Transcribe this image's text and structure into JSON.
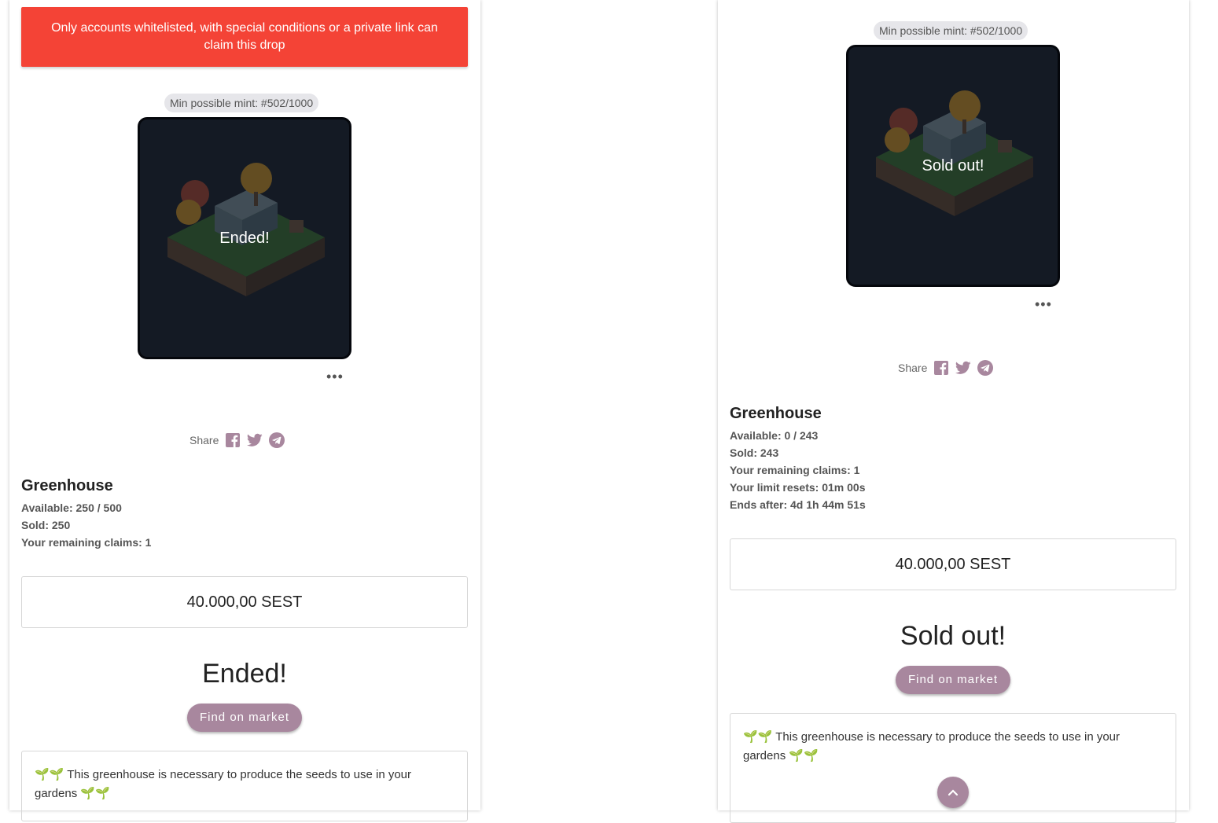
{
  "left": {
    "alert_text": "Only accounts whitelisted, with special conditions or a private link can claim this drop",
    "mint_chip": "Min possible mint: #502/1000",
    "overlay_text": "Ended!",
    "more_label": "•••",
    "share_label": "Share",
    "title": "Greenhouse",
    "stats": {
      "available": "Available: 250 / 500",
      "sold": "Sold: 250",
      "remaining": "Your remaining claims: 1"
    },
    "price": "40.000,00 SEST",
    "status": "Ended!",
    "market_button": "Find on market",
    "description": "This greenhouse is necessary to produce the seeds to use in your gardens",
    "sprout": "🌱🌱"
  },
  "right": {
    "mint_chip": "Min possible mint: #502/1000",
    "overlay_text": "Sold out!",
    "more_label": "•••",
    "share_label": "Share",
    "title": "Greenhouse",
    "stats": {
      "available": "Available: 0 / 243",
      "sold": "Sold: 243",
      "remaining": "Your remaining claims: 1",
      "limit_resets": "Your limit resets: 01m 00s",
      "ends_after": "Ends after: 4d 1h 44m 51s"
    },
    "price": "40.000,00 SEST",
    "status": "Sold out!",
    "market_button": "Find on market",
    "description": "This greenhouse is necessary to produce the seeds to use in your gardens",
    "sprout": "🌱🌱"
  },
  "icons": {
    "facebook": "facebook-icon",
    "twitter": "twitter-icon",
    "telegram": "telegram-icon",
    "scroll_top": "chevron-up-icon"
  },
  "colors": {
    "alert": "#f44336",
    "accent": "#a8879e",
    "image_bg": "#141a24"
  }
}
